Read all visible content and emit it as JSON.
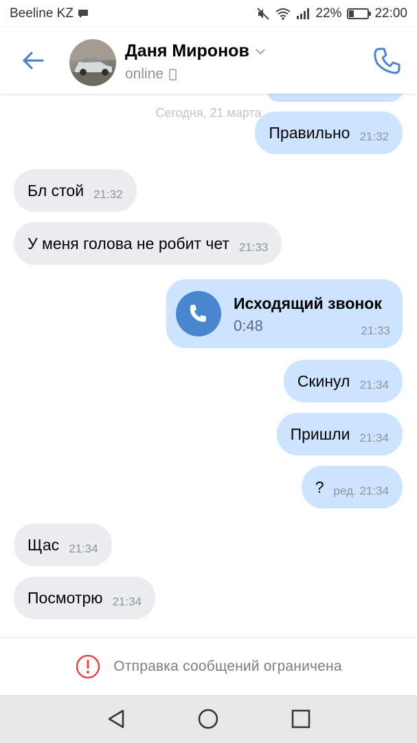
{
  "status_bar": {
    "carrier": "Beeline KZ",
    "battery": "22%",
    "battery_level": 0.22,
    "time": "22:00"
  },
  "header": {
    "contact_name": "Даня Миронов",
    "presence": "online"
  },
  "chat": {
    "date_separator": "Сегодня, 21 марта",
    "messages": [
      {
        "direction": "out",
        "text": "Правильно",
        "time": "21:32"
      },
      {
        "direction": "in",
        "text": "Бл стой",
        "time": "21:32"
      },
      {
        "direction": "in",
        "text": "У меня голова не робит чет",
        "time": "21:33"
      },
      {
        "direction": "out",
        "type": "call",
        "title": "Исходящий звонок",
        "duration": "0:48",
        "time": "21:33"
      },
      {
        "direction": "out",
        "text": "Скинул",
        "time": "21:34"
      },
      {
        "direction": "out",
        "text": "Пришли",
        "time": "21:34"
      },
      {
        "direction": "out",
        "text": "?",
        "time": "ред. 21:34"
      },
      {
        "direction": "in",
        "text": "Щас",
        "time": "21:34"
      },
      {
        "direction": "in",
        "text": "Посмотрю",
        "time": "21:34"
      }
    ]
  },
  "footer": {
    "restricted_text": "Отправка сообщений ограничена"
  },
  "colors": {
    "accent": "#4a86cf",
    "incoming_bubble": "#ebedf0",
    "outgoing_bubble": "#cce4ff",
    "warning": "#e64646"
  },
  "icons": {
    "back": "arrow-left-icon",
    "call": "phone-icon",
    "chevron": "chevron-down-icon",
    "warning": "exclamation-circle-icon"
  }
}
